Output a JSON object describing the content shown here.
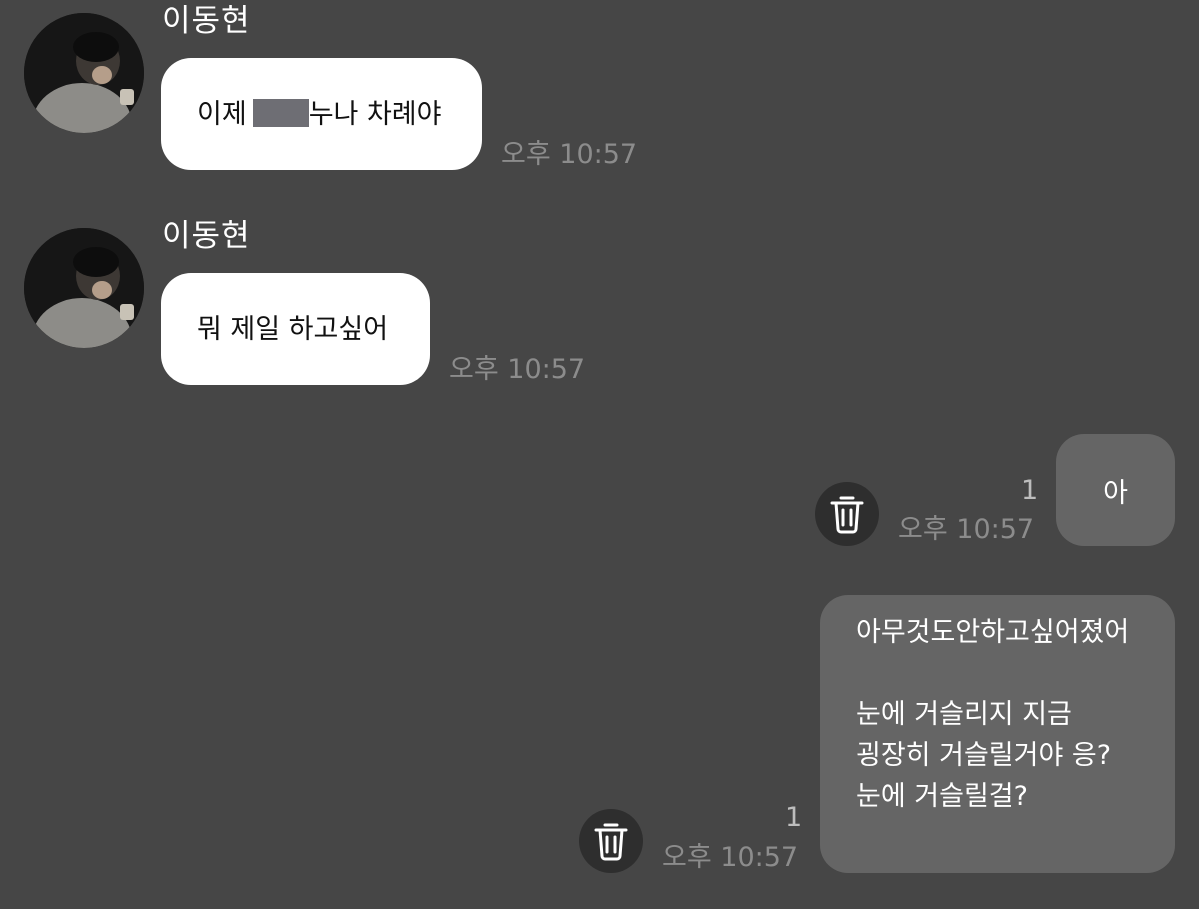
{
  "messages": [
    {
      "sender": "이동현",
      "text_before": "이제 ",
      "text_after": "누나 차례야",
      "time": "오후 10:57"
    },
    {
      "sender": "이동현",
      "text": "뭐 제일 하고싶어",
      "time": "오후 10:57"
    },
    {
      "text": "아",
      "time": "오후 10:57",
      "unread": "1"
    },
    {
      "lines": [
        "아무것도안하고싶어졌어",
        "",
        "눈에 거슬리지 지금",
        "굉장히 거슬릴거야 응?",
        "눈에 거슬릴걸?"
      ],
      "time": "오후 10:57",
      "unread": "1"
    }
  ],
  "icons": {
    "avatar": "profile-photo",
    "delete": "trash-icon"
  },
  "colors": {
    "background": "#464646",
    "incoming_bubble": "#ffffff",
    "outgoing_bubble": "#656565",
    "timestamp": "#8c8c8c"
  }
}
